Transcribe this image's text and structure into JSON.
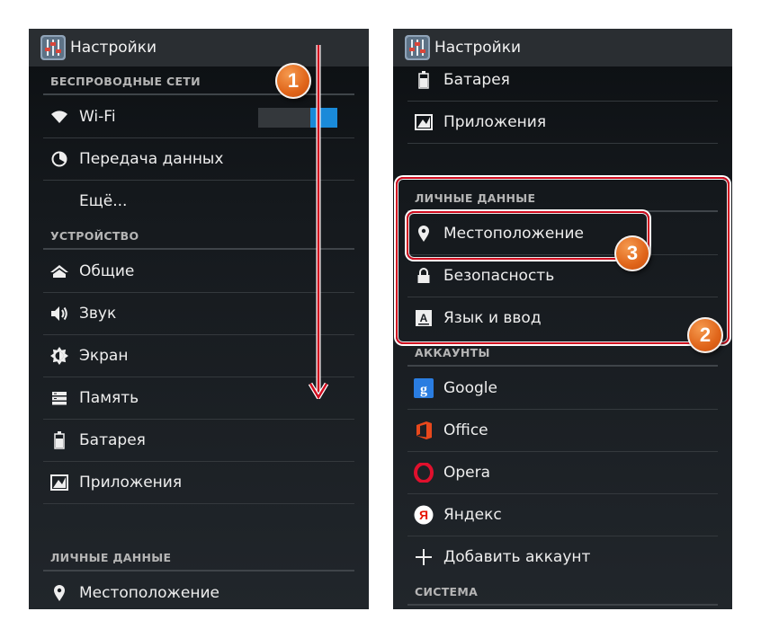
{
  "left_screen": {
    "title": "Настройки",
    "sections": {
      "wireless": "БЕСПРОВОДНЫЕ СЕТИ",
      "device": "УСТРОЙСТВО",
      "personal": "ЛИЧНЫЕ ДАННЫЕ"
    },
    "items": {
      "wifi": "Wi-Fi",
      "data": "Передача данных",
      "more": "Ещё...",
      "general": "Общие",
      "sound": "Звук",
      "screen": "Экран",
      "memory": "Память",
      "battery": "Батарея",
      "apps": "Приложения",
      "location": "Местоположение"
    },
    "wifi_toggle": "on",
    "step_badge": "1"
  },
  "right_screen": {
    "title": "Настройки",
    "sections": {
      "personal": "ЛИЧНЫЕ ДАННЫЕ",
      "accounts": "АККАУНТЫ",
      "system": "СИСТЕМА"
    },
    "items": {
      "battery": "Батарея",
      "apps": "Приложения",
      "location": "Местоположение",
      "security": "Безопасность",
      "language": "Язык и ввод",
      "google": "Google",
      "office": "Office",
      "opera": "Opera",
      "yandex": "Яндекс",
      "add_account": "Добавить аккаунт"
    },
    "step_badges": {
      "two": "2",
      "three": "3"
    }
  },
  "colors": {
    "accent_toggle": "#1a8ad9",
    "highlight_red": "#d10c1f",
    "badge_orange": "#e0651a",
    "google_blue": "#2a7de1",
    "office_orange": "#e8481c",
    "opera_red": "#e0102d",
    "yandex_red": "#e61400"
  }
}
